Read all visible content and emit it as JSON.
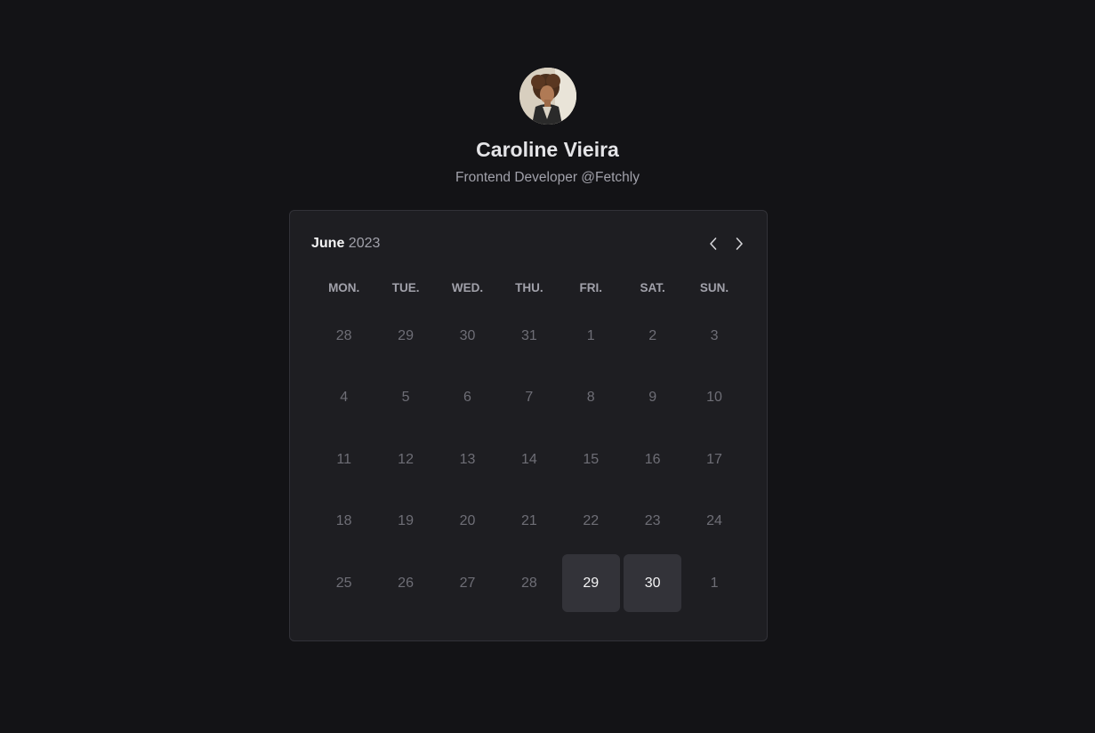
{
  "profile": {
    "name": "Caroline Vieira",
    "role": "Frontend Developer @Fetchly"
  },
  "calendar": {
    "month": "June",
    "year": "2023",
    "prev_icon": "chevron-left-icon",
    "next_icon": "chevron-right-icon",
    "weekdays": [
      "MON.",
      "TUE.",
      "WED.",
      "THU.",
      "FRI.",
      "SAT.",
      "SUN."
    ],
    "weeks": [
      [
        {
          "d": "28",
          "available": false
        },
        {
          "d": "29",
          "available": false
        },
        {
          "d": "30",
          "available": false
        },
        {
          "d": "31",
          "available": false
        },
        {
          "d": "1",
          "available": false
        },
        {
          "d": "2",
          "available": false
        },
        {
          "d": "3",
          "available": false
        }
      ],
      [
        {
          "d": "4",
          "available": false
        },
        {
          "d": "5",
          "available": false
        },
        {
          "d": "6",
          "available": false
        },
        {
          "d": "7",
          "available": false
        },
        {
          "d": "8",
          "available": false
        },
        {
          "d": "9",
          "available": false
        },
        {
          "d": "10",
          "available": false
        }
      ],
      [
        {
          "d": "11",
          "available": false
        },
        {
          "d": "12",
          "available": false
        },
        {
          "d": "13",
          "available": false
        },
        {
          "d": "14",
          "available": false
        },
        {
          "d": "15",
          "available": false
        },
        {
          "d": "16",
          "available": false
        },
        {
          "d": "17",
          "available": false
        }
      ],
      [
        {
          "d": "18",
          "available": false
        },
        {
          "d": "19",
          "available": false
        },
        {
          "d": "20",
          "available": false
        },
        {
          "d": "21",
          "available": false
        },
        {
          "d": "22",
          "available": false
        },
        {
          "d": "23",
          "available": false
        },
        {
          "d": "24",
          "available": false
        }
      ],
      [
        {
          "d": "25",
          "available": false
        },
        {
          "d": "26",
          "available": false
        },
        {
          "d": "27",
          "available": false
        },
        {
          "d": "28",
          "available": false
        },
        {
          "d": "29",
          "available": true
        },
        {
          "d": "30",
          "available": true
        },
        {
          "d": "1",
          "available": false
        }
      ]
    ]
  },
  "colors": {
    "background": "#131316",
    "card": "#1e1e22",
    "available_day": "#333339",
    "muted_text": "#6e6e76"
  }
}
